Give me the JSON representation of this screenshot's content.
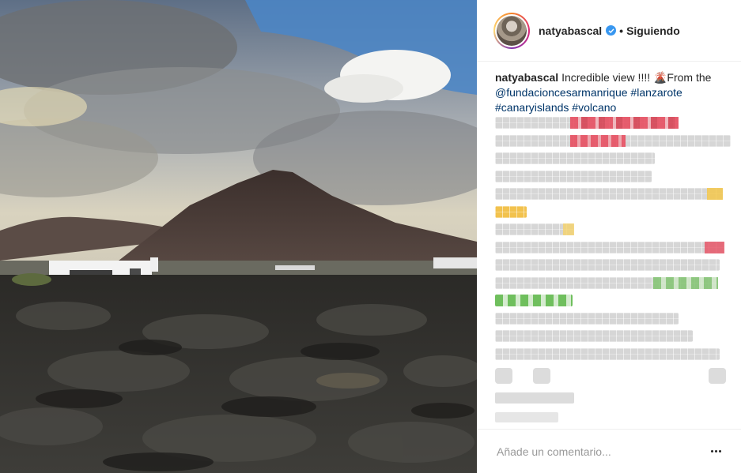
{
  "post": {
    "username": "natyabascal",
    "separator": "•",
    "follow_status": "Siguiendo",
    "caption": {
      "username": "natyabascal",
      "text": "Incredible view !!!! 🌋From the",
      "mention": "@fundacioncesarmanrique",
      "hashtags": [
        "#lanzarote",
        "#canaryislands",
        "#volcano"
      ]
    },
    "comment_placeholder": "Añade un comentario...",
    "icons": {
      "verified": "verified-badge-icon",
      "options": "more-options-icon"
    },
    "colors": {
      "link": "#003569",
      "verified": "#3897f0"
    }
  }
}
